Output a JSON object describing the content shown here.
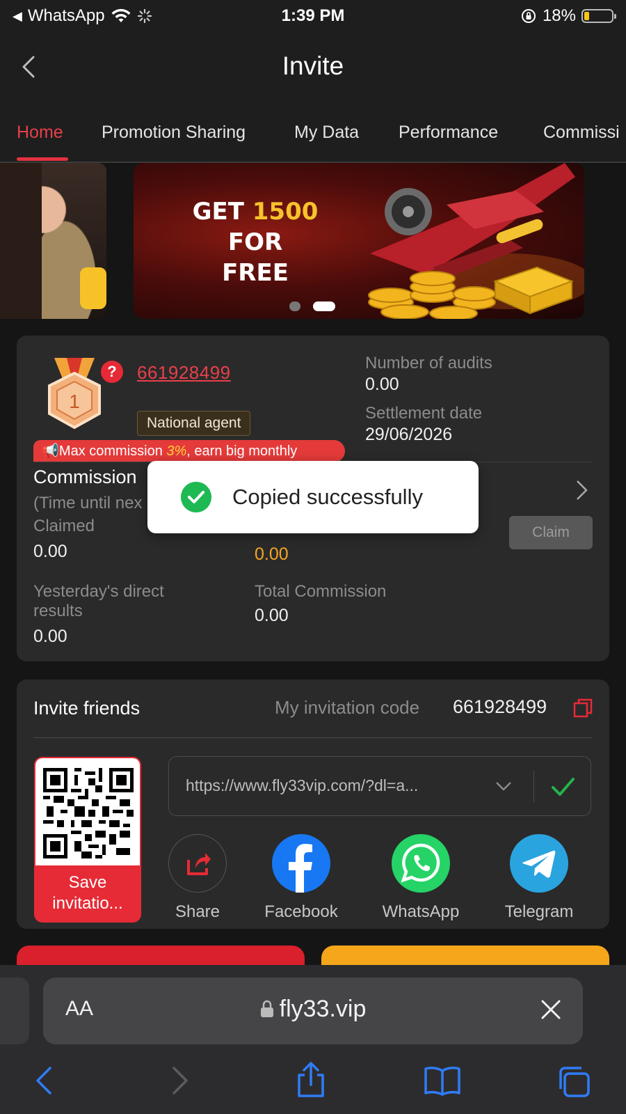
{
  "status_bar": {
    "back_app": "WhatsApp",
    "time": "1:39 PM",
    "battery": "18%"
  },
  "header": {
    "title": "Invite"
  },
  "tabs": [
    {
      "label": "Home",
      "active": true
    },
    {
      "label": "Promotion Sharing"
    },
    {
      "label": "My Data"
    },
    {
      "label": "Performance"
    },
    {
      "label": "Commissi"
    }
  ],
  "banner": {
    "headline_prefix": "GET ",
    "headline_amount": "1500",
    "headline_suffix": " FOR",
    "headline_line2": "FREE",
    "carousel_count": 2,
    "carousel_active_index": 1
  },
  "agent": {
    "rank": "1",
    "id": "661928499",
    "level": "National agent",
    "promo_prefix": "Max commission ",
    "promo_pct": "3%",
    "promo_suffix": ", earn big monthly",
    "audits_label": "Number of audits",
    "audits_value": "0.00",
    "settlement_label": "Settlement date",
    "settlement_value": "29/06/2026",
    "commission_title": "Commission",
    "time_until": "(Time until nex",
    "claimed_label": "Claimed",
    "claimed_value": "0.00",
    "claimable_value": "0.00",
    "claim_button": "Claim",
    "yesterday_label_1": "Yesterday's direct",
    "yesterday_label_2": "results",
    "yesterday_value": "0.00",
    "total_label": "Total Commission",
    "total_value": "0.00"
  },
  "toast": {
    "message": "Copied successfully"
  },
  "invite": {
    "title": "Invite friends",
    "code_label": "My invitation code",
    "code_value": "661928499",
    "link": "https://www.fly33vip.com/?dl=a...",
    "save_line1": "Save",
    "save_line2": "invitatio...",
    "share_options": [
      {
        "label": "Share",
        "icon": "share-icon"
      },
      {
        "label": "Facebook",
        "icon": "facebook-icon"
      },
      {
        "label": "WhatsApp",
        "icon": "whatsapp-icon"
      },
      {
        "label": "Telegram",
        "icon": "telegram-icon"
      }
    ]
  },
  "safari": {
    "text_size": "AA",
    "domain": "fly33.vip"
  },
  "colors": {
    "accent_red": "#e62b36",
    "accent_orange": "#f5a623",
    "background": "#151515",
    "card": "#2a2a2a"
  }
}
